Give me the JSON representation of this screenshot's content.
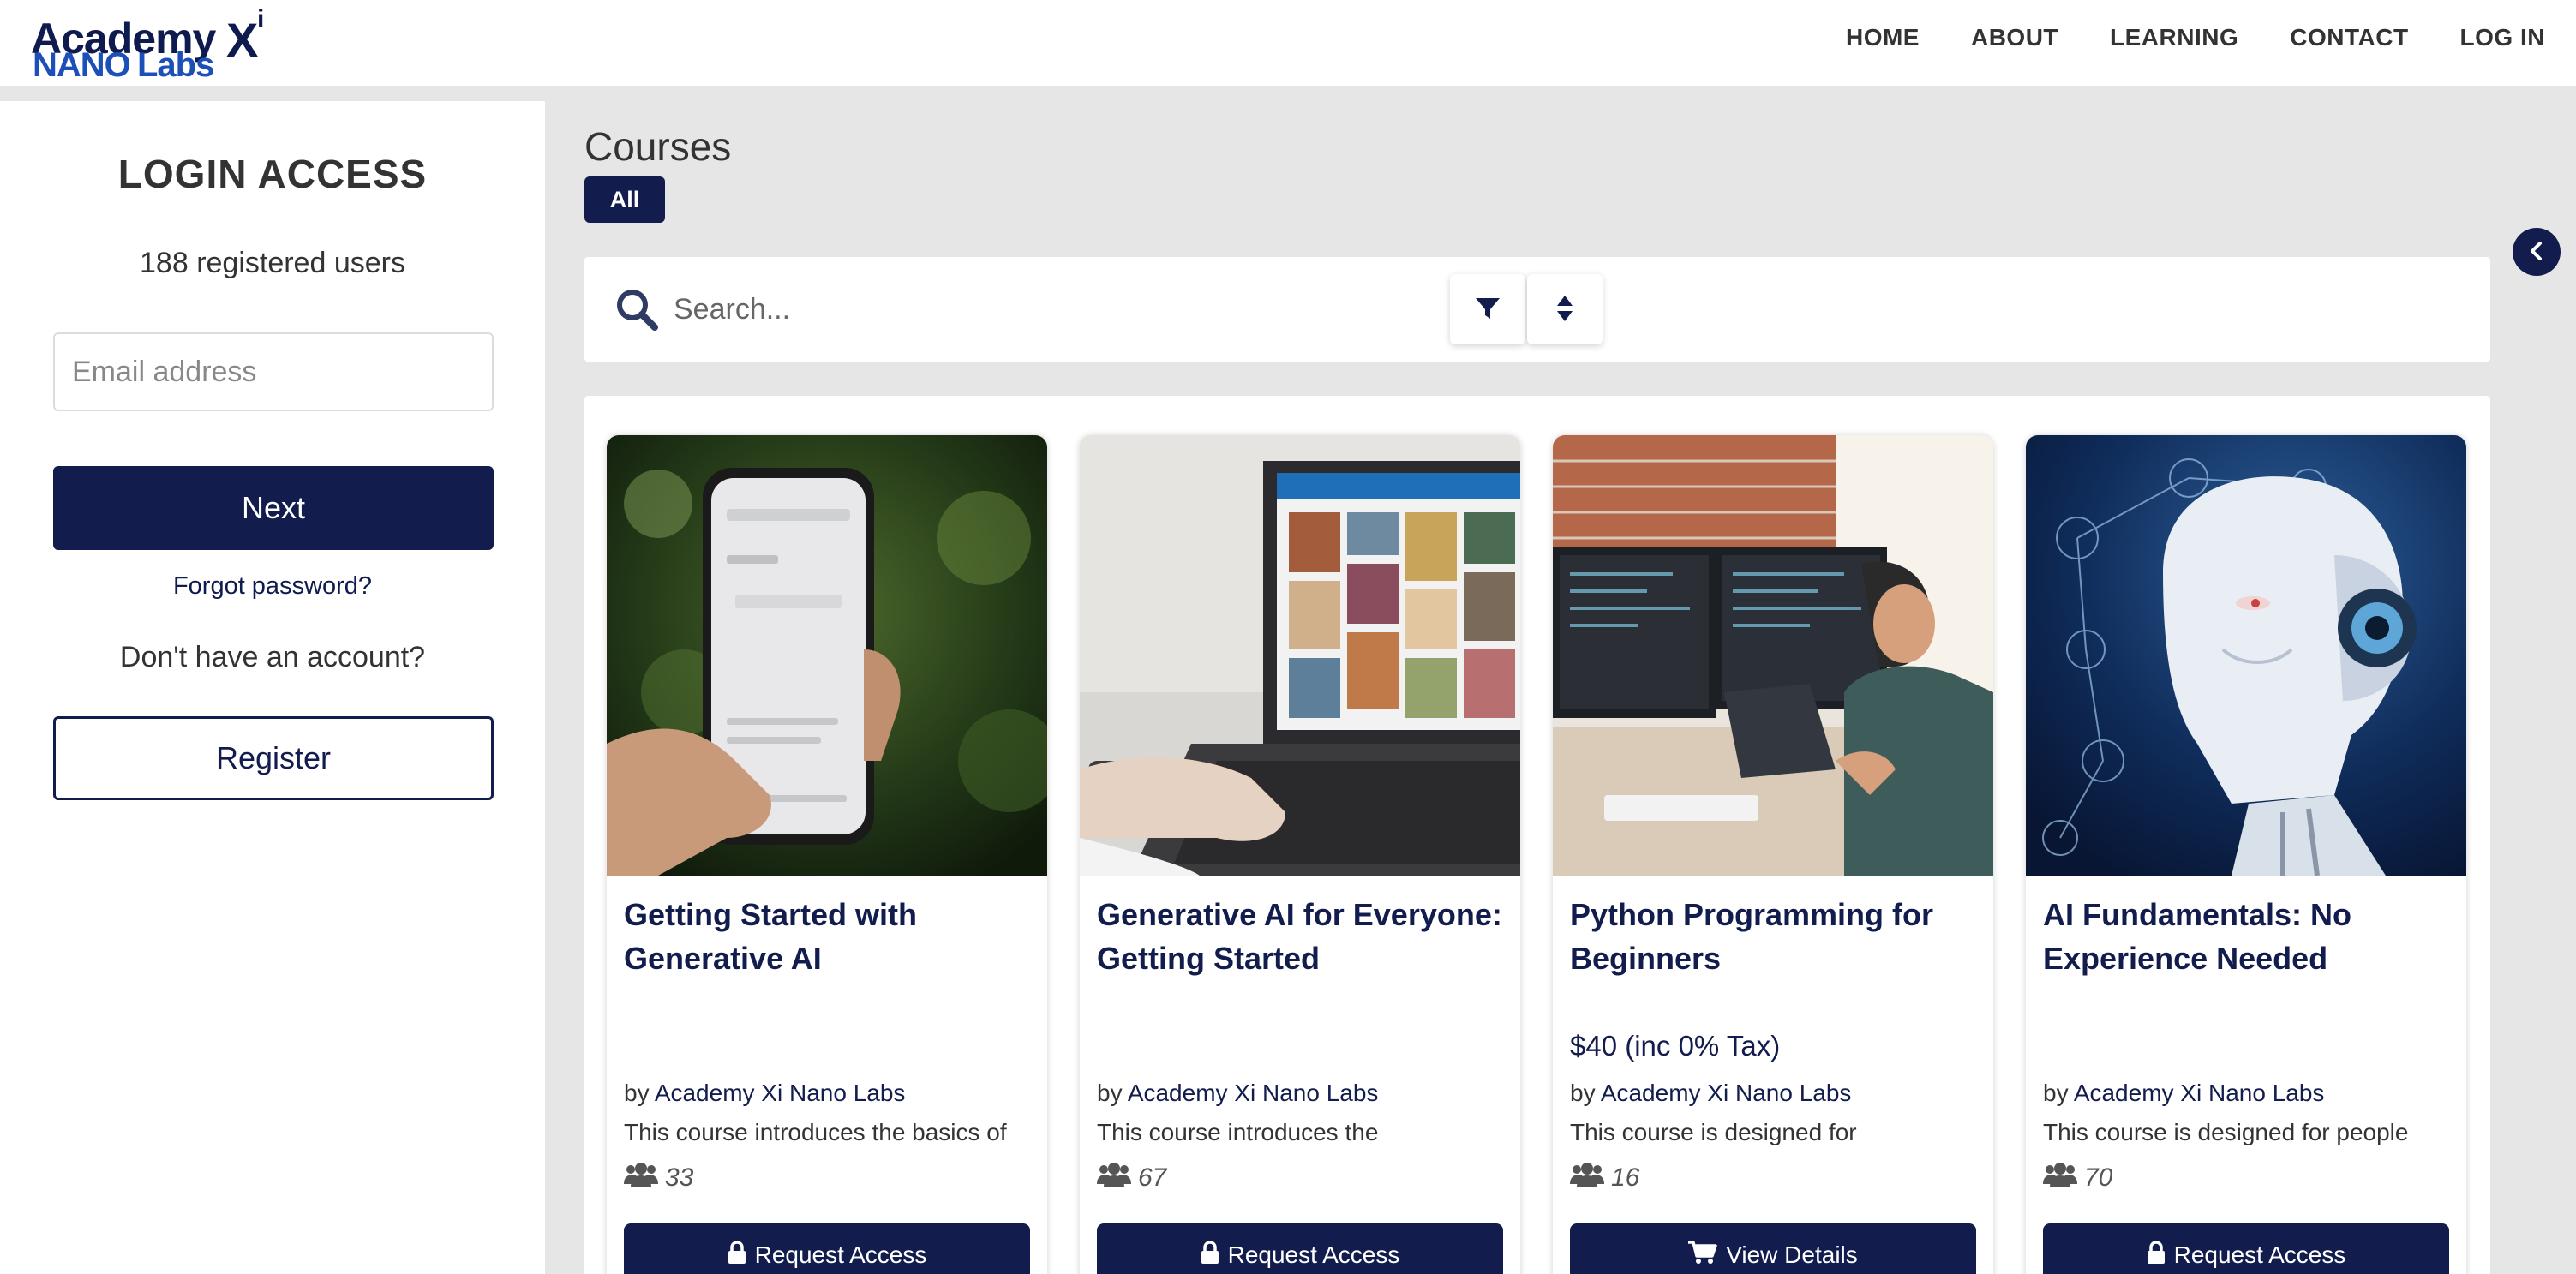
{
  "brand": {
    "line1": "Academy",
    "line1_x": "X",
    "line1_sup": "i",
    "line2_a": "NANO",
    "line2_b": "Labs",
    "primary_color": "#0f1b4f",
    "secondary_color": "#1c4fb8"
  },
  "nav": {
    "items": [
      {
        "label": "HOME"
      },
      {
        "label": "ABOUT"
      },
      {
        "label": "LEARNING"
      },
      {
        "label": "CONTACT"
      },
      {
        "label": "LOG IN"
      }
    ]
  },
  "login": {
    "title": "LOGIN ACCESS",
    "registered_users": "188 registered users",
    "email_placeholder": "Email address",
    "email_value": "",
    "next_label": "Next",
    "forgot_label": "Forgot password?",
    "no_account_text": "Don't have an account?",
    "register_label": "Register"
  },
  "courses": {
    "title": "Courses",
    "filter_chip": "All",
    "search_placeholder": "Search...",
    "filter_icon": "filter-icon",
    "sort_icon": "sort-icon",
    "collapse_icon": "chevron-left-icon",
    "accent_color": "#121c4d",
    "cards": [
      {
        "title": "Getting Started with Generative AI",
        "price": "",
        "by_prefix": "by",
        "author": "Academy Xi Nano Labs",
        "description": "This course introduces the basics of",
        "enrolled": "33",
        "button_label": "Request Access",
        "button_icon": "lock-icon",
        "image": "hand-holding-phone-chatgpt"
      },
      {
        "title": "Generative AI for Everyone: Getting Started",
        "price": "",
        "by_prefix": "by",
        "author": "Academy Xi Nano Labs",
        "description": "This course introduces the",
        "enrolled": "67",
        "button_label": "Request Access",
        "button_icon": "lock-icon",
        "image": "laptop-with-image-gallery"
      },
      {
        "title": "Python Programming for Beginners",
        "price": "$40 (inc 0% Tax)",
        "by_prefix": "by",
        "author": "Academy Xi Nano Labs",
        "description": "This course is designed for",
        "enrolled": "16",
        "button_label": "View Details",
        "button_icon": "cart-icon",
        "image": "programmer-at-desk-monitors"
      },
      {
        "title": "AI Fundamentals: No Experience Needed",
        "price": "",
        "by_prefix": "by",
        "author": "Academy Xi Nano Labs",
        "description": "This course is designed for people",
        "enrolled": "70",
        "button_label": "Request Access",
        "button_icon": "lock-icon",
        "image": "robot-head-with-network"
      }
    ]
  }
}
